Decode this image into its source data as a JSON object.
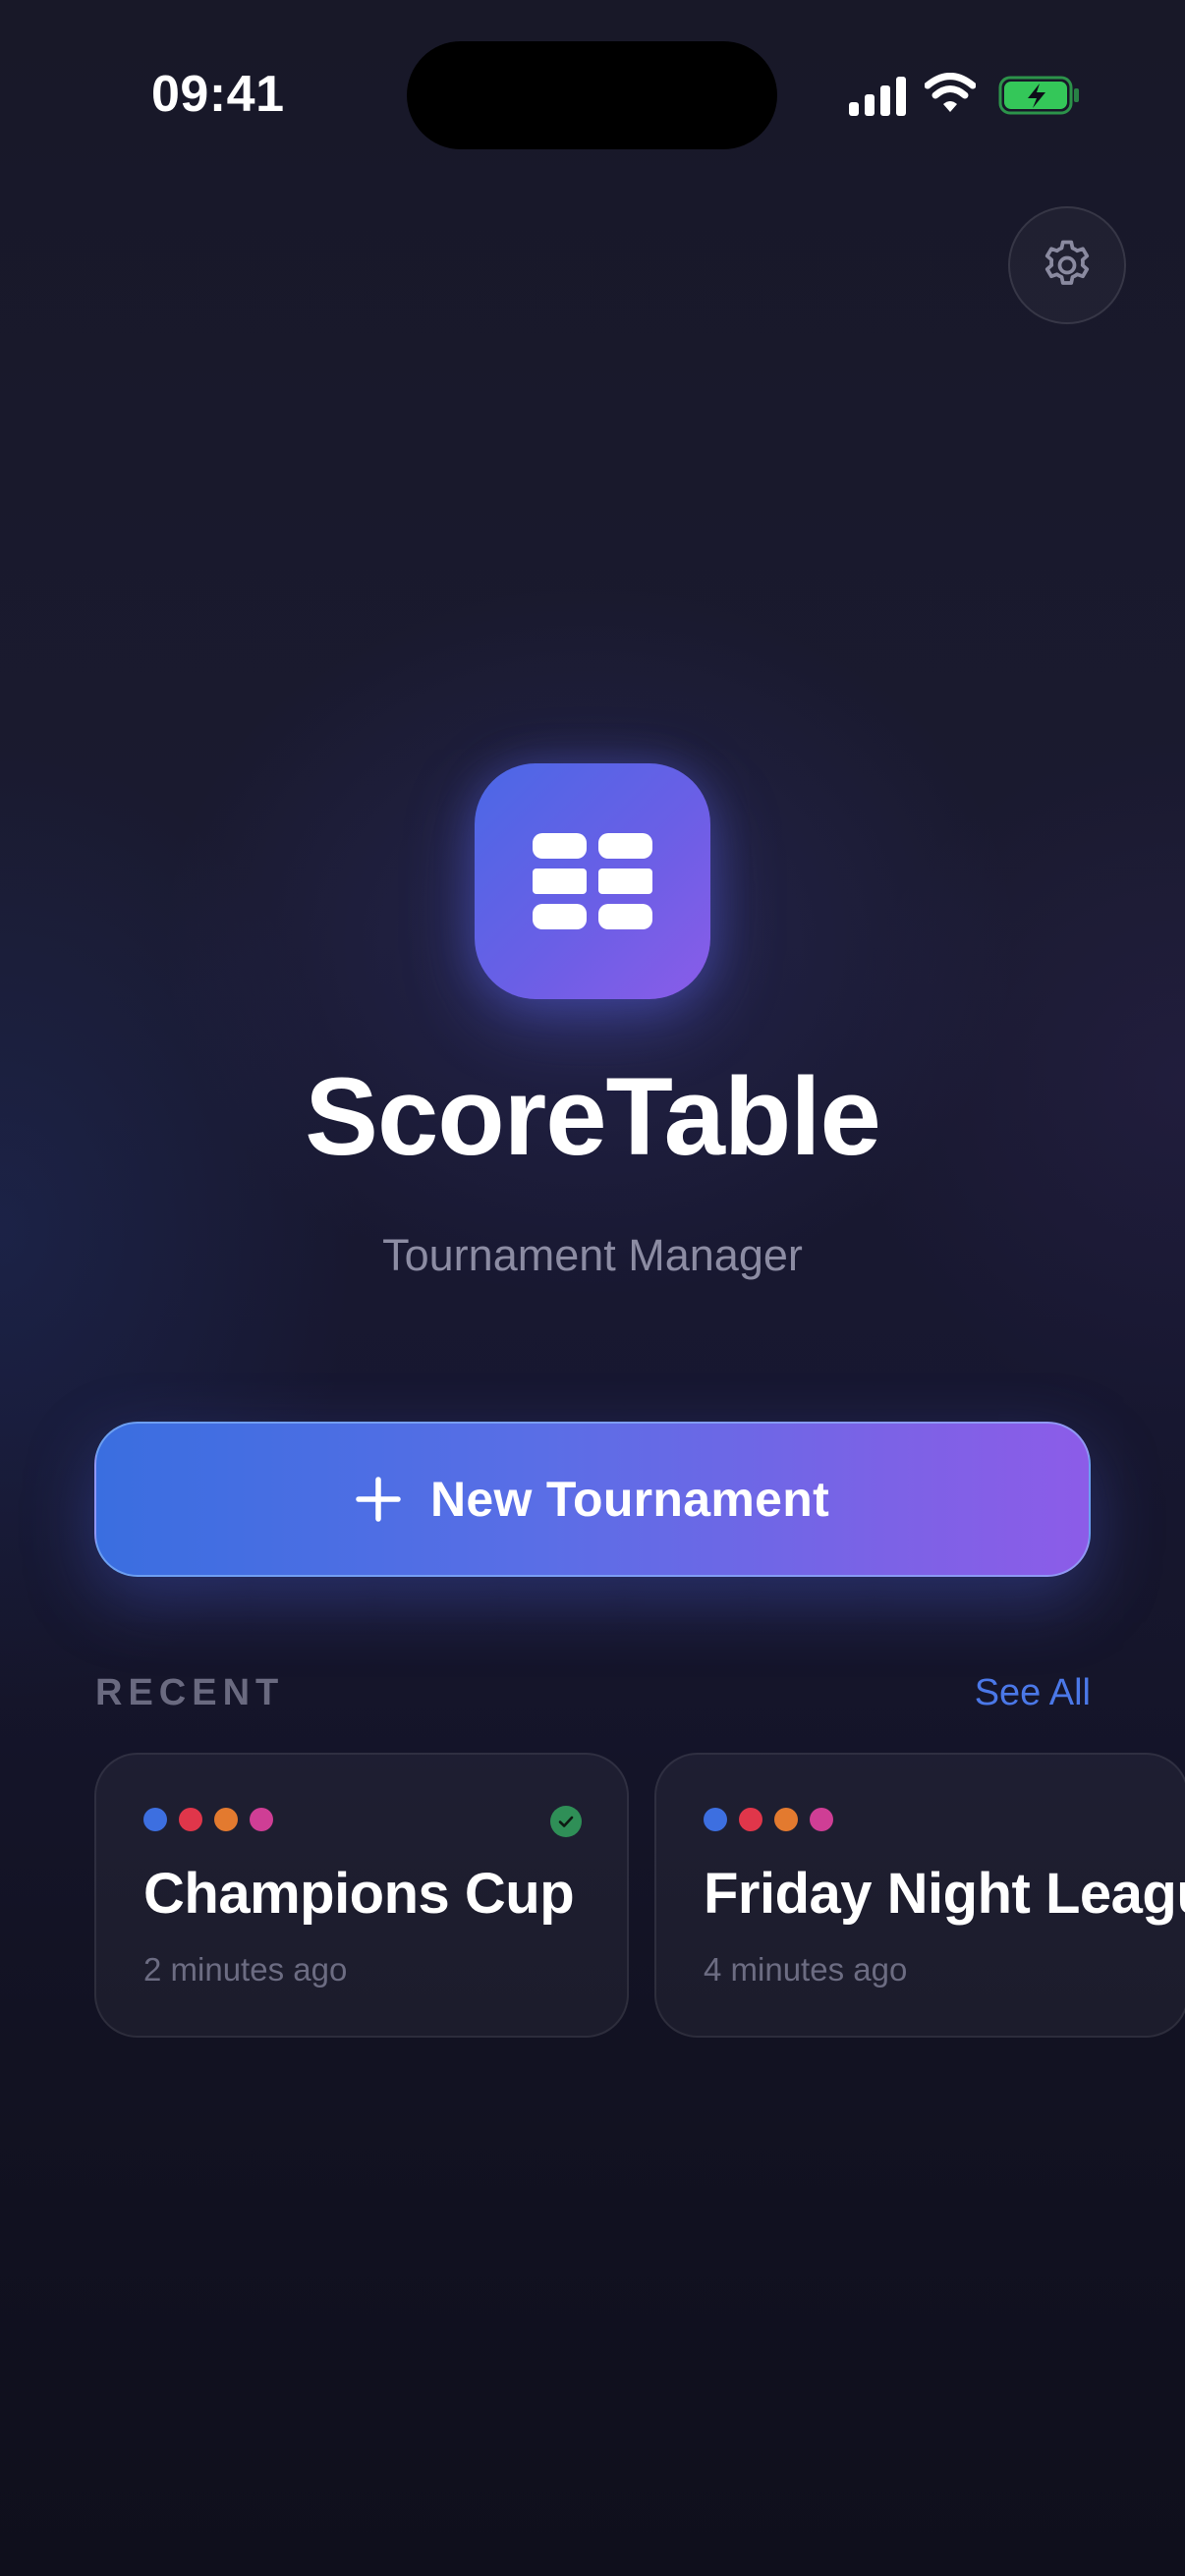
{
  "status_bar": {
    "time": "09:41",
    "icons": [
      "signal-icon",
      "wifi-icon",
      "battery-charging-icon"
    ],
    "battery_color": "#34c759"
  },
  "header": {
    "settings_icon": "gear-icon"
  },
  "hero": {
    "app_icon": "table-grid-icon",
    "title": "ScoreTable",
    "subtitle": "Tournament Manager"
  },
  "actions": {
    "new_tournament_label": "New Tournament",
    "new_tournament_icon": "plus-icon"
  },
  "recent": {
    "label": "RECENT",
    "see_all_label": "See All",
    "cards": [
      {
        "title": "Champions Cup",
        "time": "2 minutes ago",
        "dot_colors": [
          "#3d6fe0",
          "#e0364a",
          "#e37a2f",
          "#cf3e95"
        ],
        "status_icon": "check-circle-icon"
      },
      {
        "title": "Friday Night League",
        "time": "4 minutes ago",
        "dot_colors": [
          "#3d6fe0",
          "#e0364a",
          "#e37a2f",
          "#cf3e95"
        ]
      }
    ]
  },
  "colors": {
    "accent_blue": "#3a6ee0",
    "accent_purple": "#8c5ce8",
    "link": "#4b78e8",
    "background": "#141423"
  }
}
